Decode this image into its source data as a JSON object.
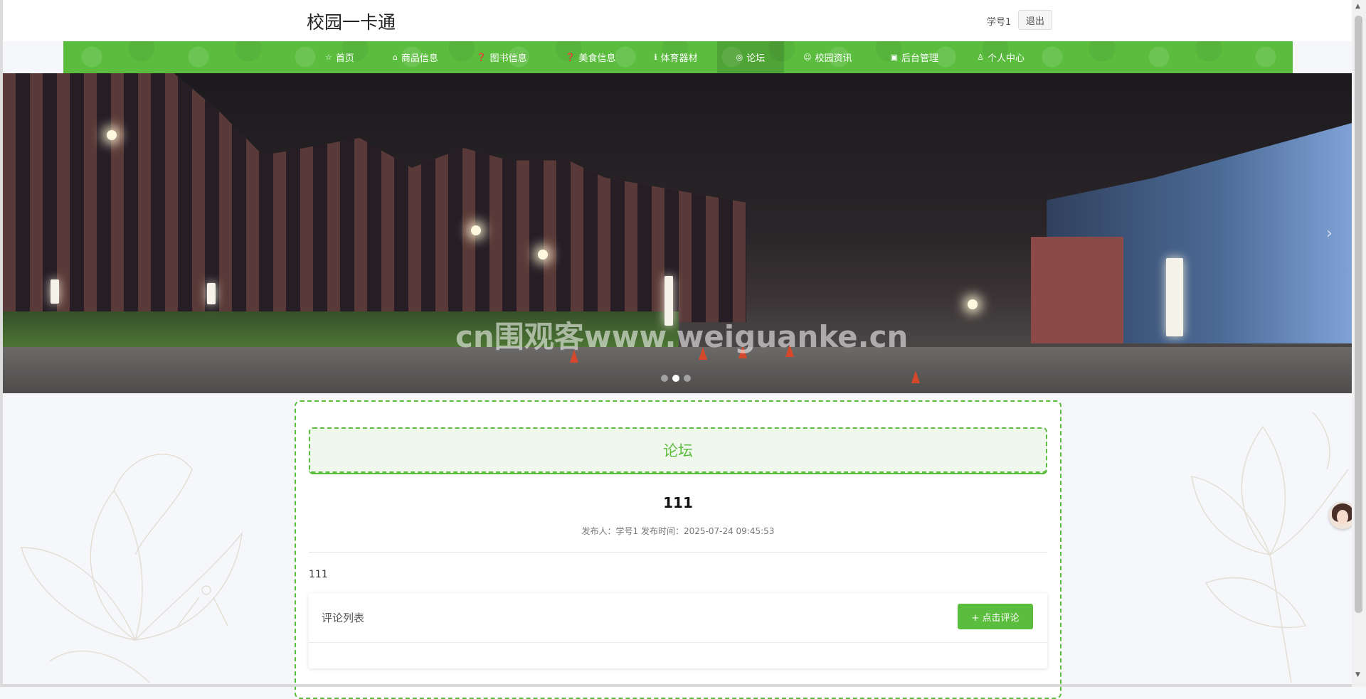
{
  "header": {
    "site_title": "校园一卡通",
    "user_label": "学号1",
    "logout_label": "退出"
  },
  "nav": {
    "items": [
      {
        "label": "首页",
        "icon": "star-icon",
        "glyph": "☆"
      },
      {
        "label": "商品信息",
        "icon": "bag-icon",
        "glyph": "⌂"
      },
      {
        "label": "图书信息",
        "icon": "question-icon",
        "glyph": "❓"
      },
      {
        "label": "美食信息",
        "icon": "question-icon",
        "glyph": "❓"
      },
      {
        "label": "体育器材",
        "icon": "info-icon",
        "glyph": "ℹ"
      },
      {
        "label": "论坛",
        "icon": "globe-icon",
        "glyph": "◎"
      },
      {
        "label": "校园资讯",
        "icon": "smile-icon",
        "glyph": "☺"
      },
      {
        "label": "后台管理",
        "icon": "gift-icon",
        "glyph": "▣"
      },
      {
        "label": "个人中心",
        "icon": "user-icon",
        "glyph": "♙"
      }
    ],
    "active_index": 5,
    "bar_color": "#5bbd3e"
  },
  "banner": {
    "watermark": "cn围观客www.weiguanke.cn",
    "slide_count": 3,
    "active_slide": 1,
    "next_glyph": "›"
  },
  "forum": {
    "section_title": "论坛",
    "post_title": "111",
    "post_meta": "发布人：学号1  发布时间：2025-07-24 09:45:53",
    "post_content": "111",
    "comments_title": "评论列表",
    "comment_button": "+ 点击评论"
  },
  "colors": {
    "accent": "#5bbd3e",
    "header_bg": "#ffffff",
    "page_bg": "#f6f7fb"
  }
}
